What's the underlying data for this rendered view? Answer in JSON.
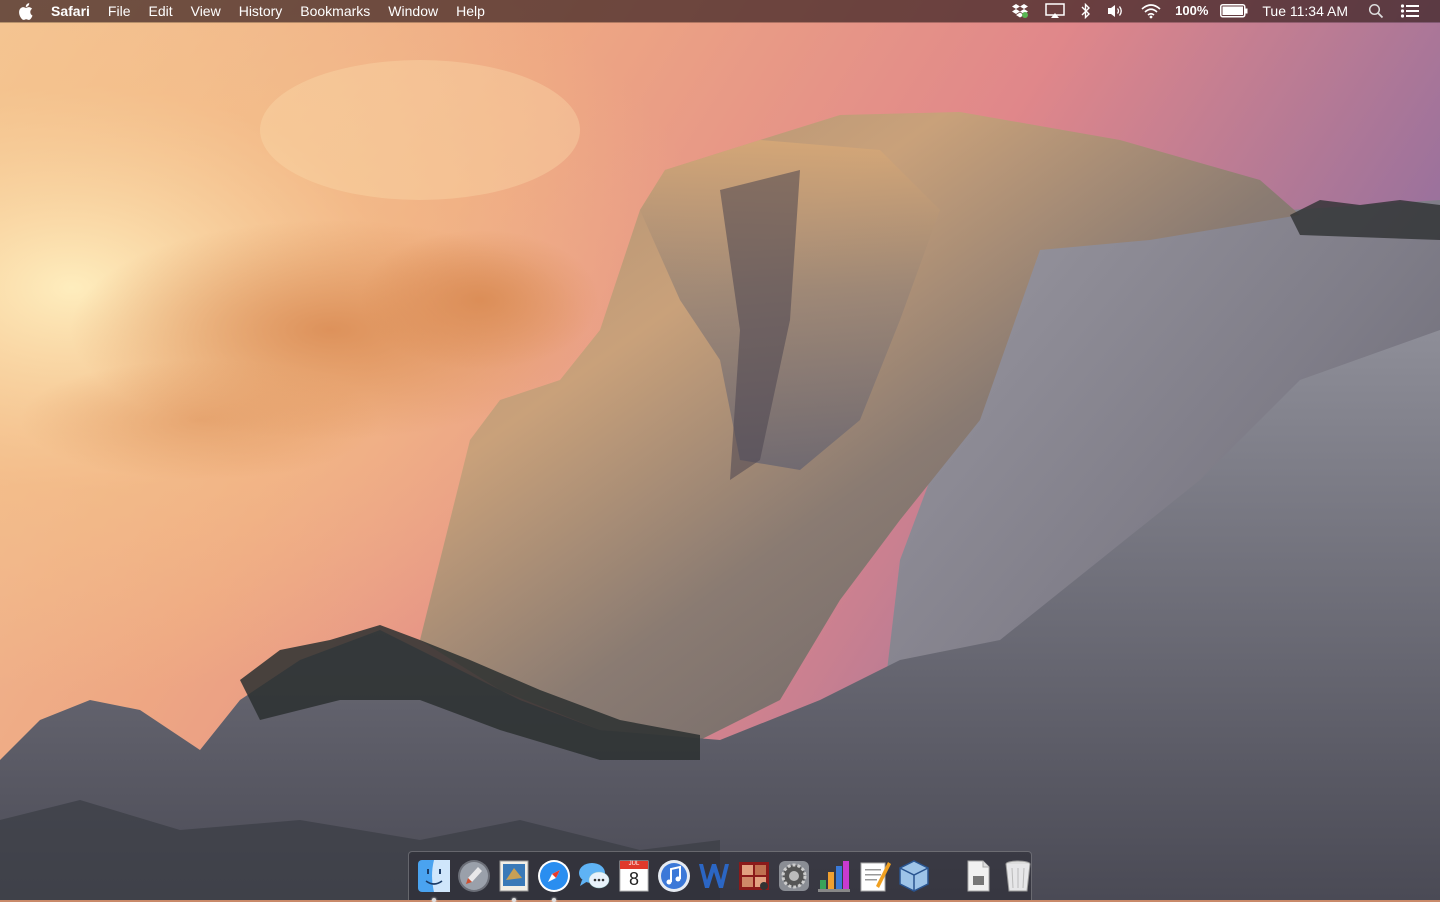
{
  "menubar": {
    "app_name": "Safari",
    "menus": [
      "File",
      "Edit",
      "View",
      "History",
      "Bookmarks",
      "Window",
      "Help"
    ],
    "status": {
      "battery_percent": "100%",
      "clock": "Tue 11:34 AM"
    }
  },
  "dock": {
    "calendar": {
      "month": "JUL",
      "day": "8"
    },
    "apps": [
      {
        "icon": "finder-icon",
        "running": true
      },
      {
        "icon": "launchpad-icon",
        "running": false
      },
      {
        "icon": "mail-icon",
        "running": true
      },
      {
        "icon": "safari-icon",
        "running": true
      },
      {
        "icon": "messages-icon",
        "running": false
      },
      {
        "icon": "calendar-icon",
        "running": false
      },
      {
        "icon": "itunes-icon",
        "running": false
      },
      {
        "icon": "word-icon",
        "running": false
      },
      {
        "icon": "photo-booth-icon",
        "running": false
      },
      {
        "icon": "system-preferences-icon",
        "running": false
      },
      {
        "icon": "numbers-icon",
        "running": false
      },
      {
        "icon": "pages-icon",
        "running": false
      },
      {
        "icon": "virtualbox-icon",
        "running": false
      }
    ],
    "right_items": [
      {
        "icon": "documents-stack-icon"
      },
      {
        "icon": "trash-icon"
      }
    ]
  },
  "colors": {
    "menubar_bg": "#3c2323",
    "sky_top": "#e59a8f",
    "sky_glow": "#f6c489",
    "rock_light": "#c8a27a",
    "rock_shadow": "#5a5560"
  }
}
